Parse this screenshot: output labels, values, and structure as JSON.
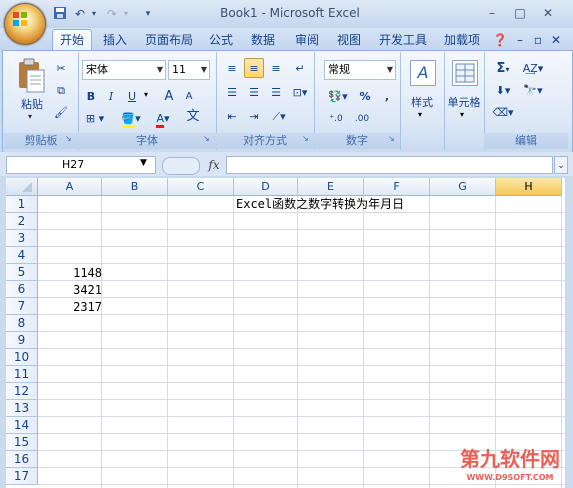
{
  "window": {
    "title": "Book1 - Microsoft Excel"
  },
  "quick_access": {
    "save_icon": "save-icon",
    "undo_icon": "undo-icon",
    "redo_icon": "redo-icon",
    "customize_icon": "dropdown-icon"
  },
  "tabs": [
    "开始",
    "插入",
    "页面布局",
    "公式",
    "数据",
    "审阅",
    "视图",
    "开发工具",
    "加载项"
  ],
  "active_tab": "开始",
  "ribbon": {
    "clipboard": {
      "label": "剪贴板",
      "paste_label": "粘贴"
    },
    "font": {
      "label": "字体",
      "font_name": "宋体",
      "font_size": "11",
      "bold": "B",
      "italic": "I",
      "underline": "U",
      "grow": "A",
      "shrink": "A",
      "color_a": "A",
      "phonetic": "文"
    },
    "alignment": {
      "label": "对齐方式"
    },
    "number": {
      "label": "数字",
      "format": "常规",
      "percent": "%",
      "comma": ","
    },
    "styles": {
      "label": "样式"
    },
    "cells": {
      "label": "单元格"
    },
    "editing": {
      "label": "编辑",
      "sum": "Σ"
    }
  },
  "formula_bar": {
    "name_box": "H27",
    "fx": "fx",
    "content": ""
  },
  "columns": [
    "A",
    "B",
    "C",
    "D",
    "E",
    "F",
    "G",
    "H"
  ],
  "selected_column": "H",
  "rows": [
    "1",
    "2",
    "3",
    "4",
    "5",
    "6",
    "7",
    "8",
    "9",
    "10",
    "11",
    "12",
    "13",
    "14",
    "15",
    "16",
    "17"
  ],
  "cells": {
    "D1": "Excel函数之数字转换为年月日",
    "A5": "1148",
    "A6": "3421",
    "A7": "2317"
  },
  "watermark": {
    "text": "第九软件网",
    "sub": "WWW.D9SOFT.COM",
    "color": "#e8443a"
  }
}
